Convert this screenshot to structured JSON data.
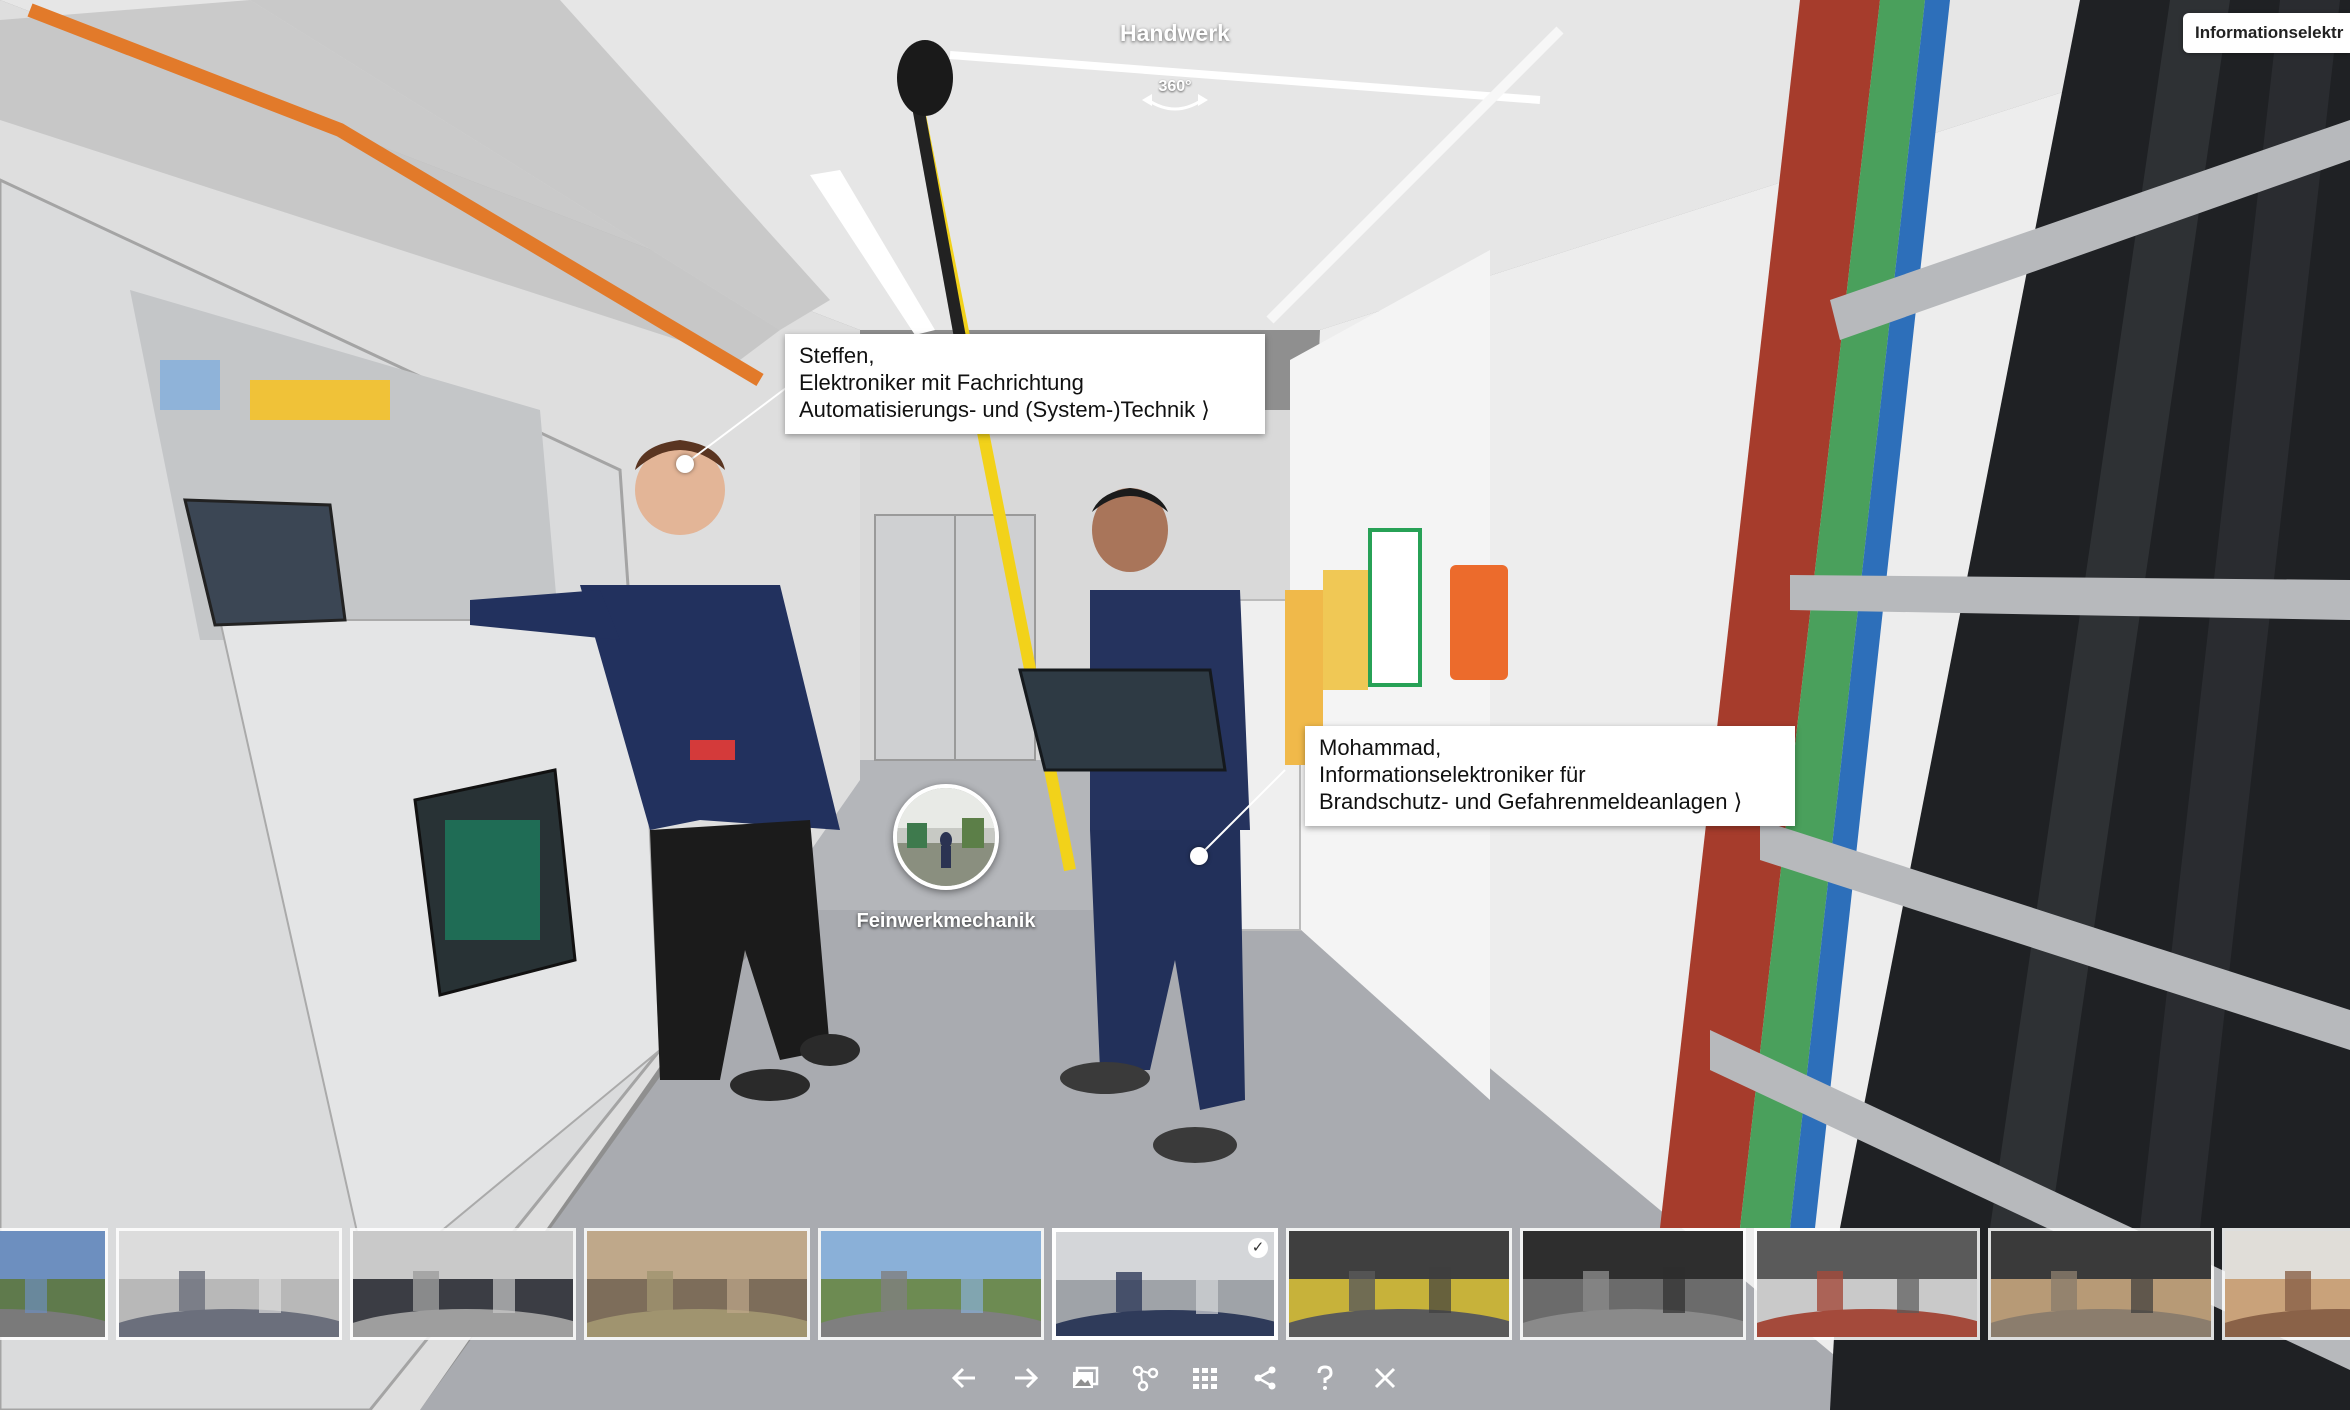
{
  "header": {
    "scene_title": "Handwerk",
    "view_badge": "360°",
    "info_tab_label": "Informationselektr"
  },
  "hotspots": {
    "steffen": {
      "lines": [
        "Steffen,",
        "Elektroniker mit Fachrichtung",
        "Automatisierungs- und (System-)Technik ⟩"
      ]
    },
    "mohammad": {
      "lines": [
        "Mohammad,",
        "Informationselektroniker für",
        "Brandschutz- und Gefahrenmeldeanlagen ⟩"
      ]
    }
  },
  "navigation": {
    "next_scene_label": "Feinwerkmechanik",
    "icon": "scene-thumbnail-icon"
  },
  "thumbnails": {
    "count": 11,
    "active_index": 5,
    "active_marker": "✓"
  },
  "toolbar": {
    "items": [
      {
        "name": "previous-arrow-icon"
      },
      {
        "name": "next-arrow-icon"
      },
      {
        "name": "gallery-icon"
      },
      {
        "name": "network-icon"
      },
      {
        "name": "grid-icon"
      },
      {
        "name": "share-icon"
      },
      {
        "name": "help-icon"
      },
      {
        "name": "close-icon"
      }
    ]
  },
  "colors": {
    "wall": "#e9e9e9",
    "floor": "#a8aaae",
    "ceiling": "#e4e4e4",
    "cabinet": "#dcdcdc",
    "cable_tray_accent": "#e27a2a",
    "pole_yellow": "#f2d21a",
    "uniform_navy": "#1f2c55",
    "ui_white": "#ffffff"
  }
}
